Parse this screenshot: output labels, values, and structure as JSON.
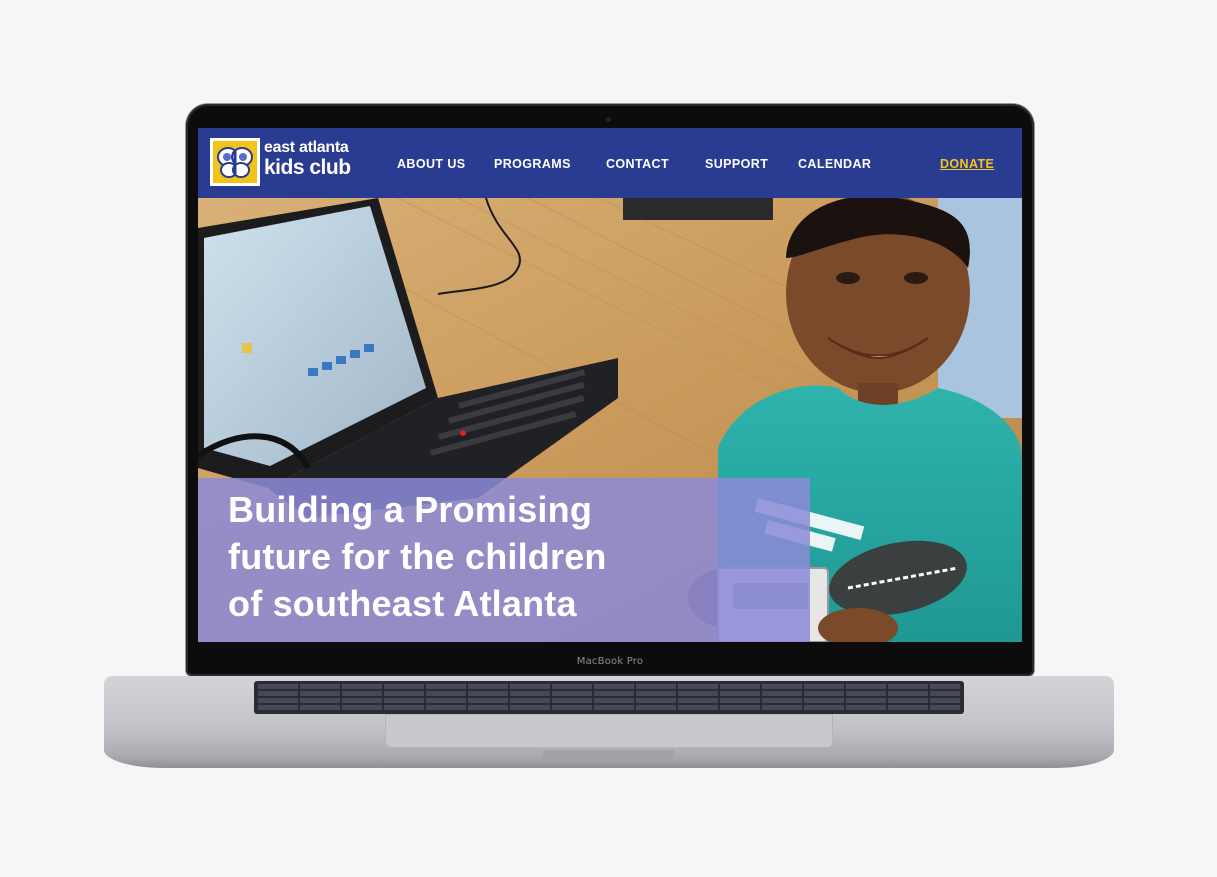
{
  "device": {
    "label": "MacBook Pro"
  },
  "site": {
    "logo": {
      "line1": "east atlanta",
      "line2": "kids club",
      "icon": "butterfly-logo-icon"
    },
    "nav": {
      "about": "ABOUT US",
      "programs": "PROGRAMS",
      "contact": "CONTACT",
      "support": "SUPPORT",
      "calendar": "CALENDAR",
      "donate": "DONATE"
    },
    "hero": {
      "title_line1": "Building a Promising",
      "title_line2": "future for the children",
      "title_line3": "of southeast Atlanta",
      "photo": "child-with-laptop-photo"
    }
  },
  "colors": {
    "header_bg": "#2a3b92",
    "donate": "#f5c518",
    "hero_overlay": "#8c8ad7"
  }
}
